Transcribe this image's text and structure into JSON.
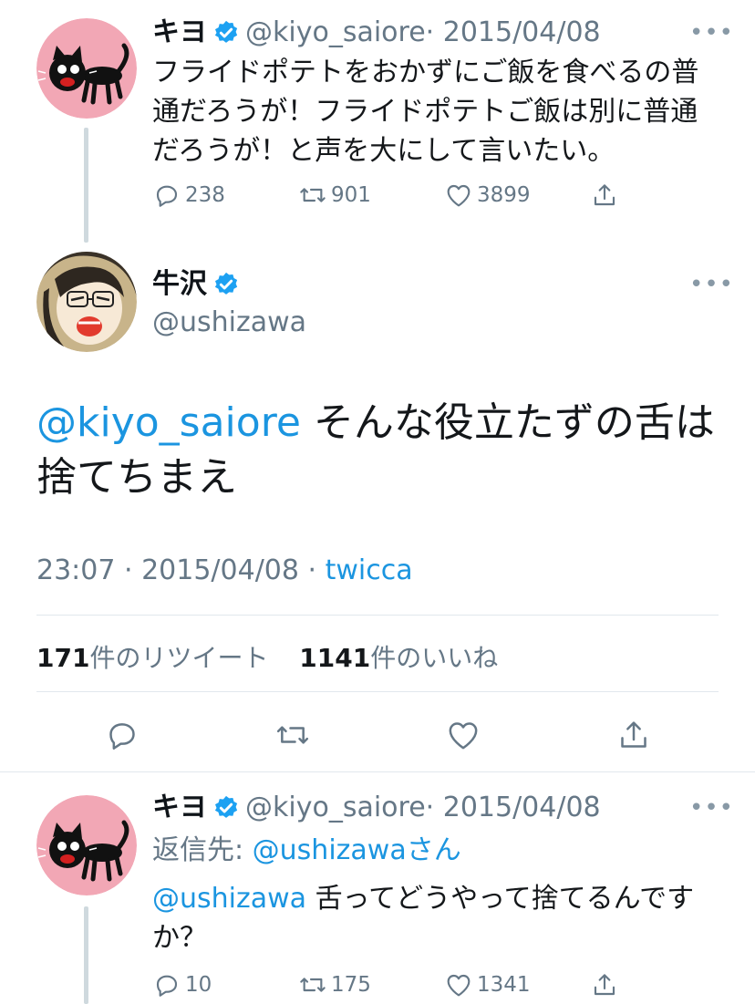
{
  "tweet1": {
    "name": "キヨ",
    "handle": "@kiyo_saiore",
    "date": "· 2015/04/08",
    "text_line1": "フライドポテトをおかずにご飯を食べるの普",
    "text_line2": "通だろうが！フライドポテトご飯は別に普通",
    "text_line3": "だろうが！と声を大にして言いたい。",
    "replies": "238",
    "retweets": "901",
    "likes": "3899"
  },
  "main_tweet": {
    "name": "牛沢",
    "handle": "@ushizawa",
    "mention": "@kiyo_saiore",
    "text_rest": " そんな役立たずの舌は",
    "text_line2": "捨てちまえ",
    "time": "23:07 · 2015/04/08 · ",
    "source": "twicca",
    "retweet_count": "171",
    "retweet_label": "件のリツイート",
    "like_count": "1141",
    "like_label": "件のいいね"
  },
  "tweet3": {
    "name": "キヨ",
    "handle": "@kiyo_saiore",
    "date": "· 2015/04/08",
    "reply_prefix": "返信先: ",
    "reply_to": "@ushizawaさん",
    "mention": "@ushizawa",
    "text_rest": " 舌ってどうやって捨てるんです",
    "text_line2": "か？",
    "replies": "10",
    "retweets": "175",
    "likes": "1341"
  },
  "more_glyph": "•••",
  "colors": {
    "link": "#1b95e0",
    "muted": "#657786",
    "verified": "#1da1f2",
    "avatar_pink": "#f2a7b5"
  },
  "icons": [
    "reply-icon",
    "retweet-icon",
    "like-icon",
    "share-icon",
    "verified-icon",
    "more-icon"
  ]
}
